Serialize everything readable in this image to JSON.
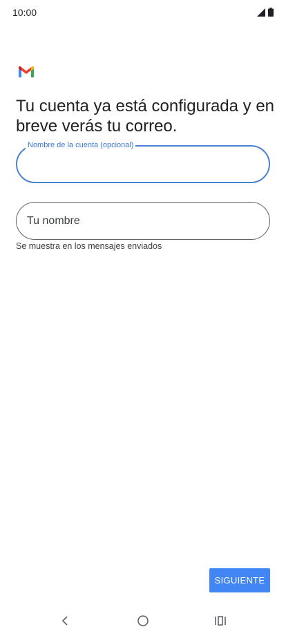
{
  "status_bar": {
    "time": "10:00",
    "icons": [
      "signal-icon",
      "battery-icon"
    ]
  },
  "logo": {
    "icon": "gmail-logo-icon",
    "colors": [
      "#4285F4",
      "#EA4335",
      "#FBBC04",
      "#34A853",
      "#C5221F"
    ]
  },
  "headline": "Tu cuenta ya está configurada y en breve verás tu correo.",
  "account_name_field": {
    "label": "Nombre de la cuenta (opcional)",
    "value": ""
  },
  "your_name_field": {
    "placeholder": "Tu nombre",
    "value": "",
    "helper": "Se muestra en los mensajes enviados"
  },
  "next_button": {
    "label": "SIGUIENTE",
    "color": "#4285F4"
  },
  "nav_bar": {
    "icons": [
      "back-icon",
      "home-icon",
      "recents-icon"
    ]
  },
  "colors": {
    "focus_outline": "#4A80D0",
    "text_primary": "#202124"
  }
}
